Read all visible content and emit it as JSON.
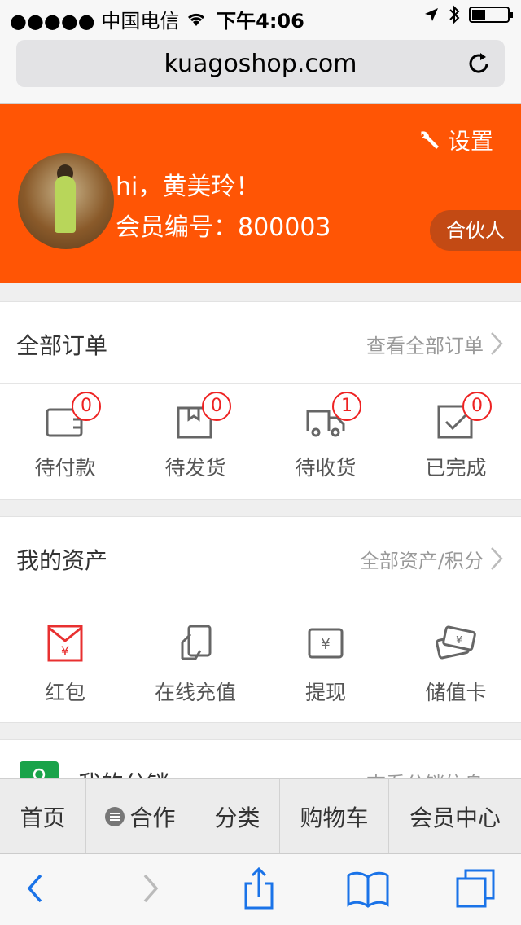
{
  "status_bar": {
    "carrier": "●●●●● 中国电信",
    "time": "下午4:06",
    "battery_level": 0.35
  },
  "browser": {
    "url": "kuagoshop.com"
  },
  "profile": {
    "settings_label": "设置",
    "greeting": "hi，黄美玲！",
    "member_number": "会员编号：800003",
    "partner_label": "合伙人"
  },
  "orders": {
    "title": "全部订单",
    "more": "查看全部订单",
    "items": [
      {
        "label": "待付款",
        "count": "0"
      },
      {
        "label": "待发货",
        "count": "0"
      },
      {
        "label": "待收货",
        "count": "1"
      },
      {
        "label": "已完成",
        "count": "0"
      }
    ]
  },
  "assets": {
    "title": "我的资产",
    "more": "全部资产/积分",
    "items": [
      {
        "label": "红包"
      },
      {
        "label": "在线充值"
      },
      {
        "label": "提现"
      },
      {
        "label": "储值卡"
      }
    ]
  },
  "distribution": {
    "title": "我的分销",
    "more": "查看分销信息"
  },
  "tabbar": {
    "items": [
      "首页",
      "合作",
      "分类",
      "购物车",
      "会员中心"
    ]
  },
  "colors": {
    "brand": "#ff5505",
    "badge": "#e22222",
    "red_envelope": "#e83030",
    "distribution_icon": "#1aa34a"
  }
}
